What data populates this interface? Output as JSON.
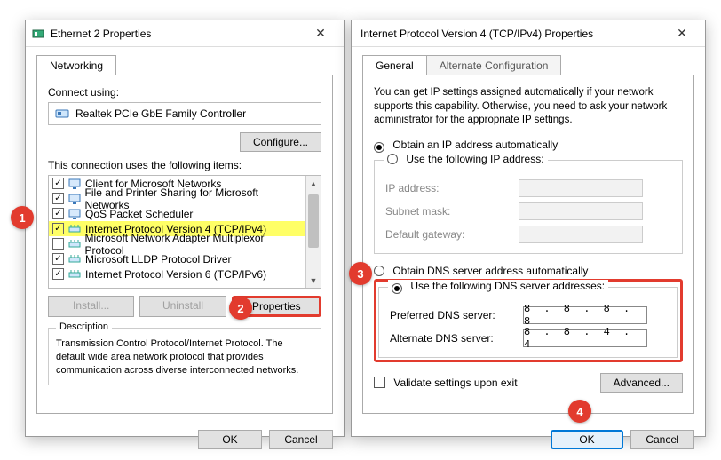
{
  "steps": {
    "1": "1",
    "2": "2",
    "3": "3",
    "4": "4"
  },
  "left": {
    "title": "Ethernet 2 Properties",
    "tab": "Networking",
    "connect_label": "Connect using:",
    "adapter": "Realtek PCIe GbE Family Controller",
    "configure": "Configure...",
    "items_label": "This connection uses the following items:",
    "items": [
      {
        "checked": true,
        "label": "Client for Microsoft Networks",
        "hl": false,
        "icon": "monitor"
      },
      {
        "checked": true,
        "label": "File and Printer Sharing for Microsoft Networks",
        "hl": false,
        "icon": "monitor"
      },
      {
        "checked": true,
        "label": "QoS Packet Scheduler",
        "hl": false,
        "icon": "monitor"
      },
      {
        "checked": true,
        "label": "Internet Protocol Version 4 (TCP/IPv4)",
        "hl": true,
        "icon": "net"
      },
      {
        "checked": false,
        "label": "Microsoft Network Adapter Multiplexor Protocol",
        "hl": false,
        "icon": "net"
      },
      {
        "checked": true,
        "label": "Microsoft LLDP Protocol Driver",
        "hl": false,
        "icon": "net"
      },
      {
        "checked": true,
        "label": "Internet Protocol Version 6 (TCP/IPv6)",
        "hl": false,
        "icon": "net"
      }
    ],
    "install": "Install...",
    "uninstall": "Uninstall",
    "properties": "Properties",
    "desc_title": "Description",
    "desc": "Transmission Control Protocol/Internet Protocol. The default wide area network protocol that provides communication across diverse interconnected networks.",
    "ok": "OK",
    "cancel": "Cancel"
  },
  "right": {
    "title": "Internet Protocol Version 4 (TCP/IPv4) Properties",
    "tab1": "General",
    "tab2": "Alternate Configuration",
    "intro": "You can get IP settings assigned automatically if your network supports this capability. Otherwise, you need to ask your network administrator for the appropriate IP settings.",
    "ip_auto": "Obtain an IP address automatically",
    "ip_manual": "Use the following IP address:",
    "ip_label": "IP address:",
    "mask_label": "Subnet mask:",
    "gw_label": "Default gateway:",
    "dns_auto": "Obtain DNS server address automatically",
    "dns_manual": "Use the following DNS server addresses:",
    "dns1_label": "Preferred DNS server:",
    "dns2_label": "Alternate DNS server:",
    "dns1": "8 . 8 . 8 . 8",
    "dns2": "8 . 8 . 4 . 4",
    "validate": "Validate settings upon exit",
    "advanced": "Advanced...",
    "ok": "OK",
    "cancel": "Cancel"
  }
}
